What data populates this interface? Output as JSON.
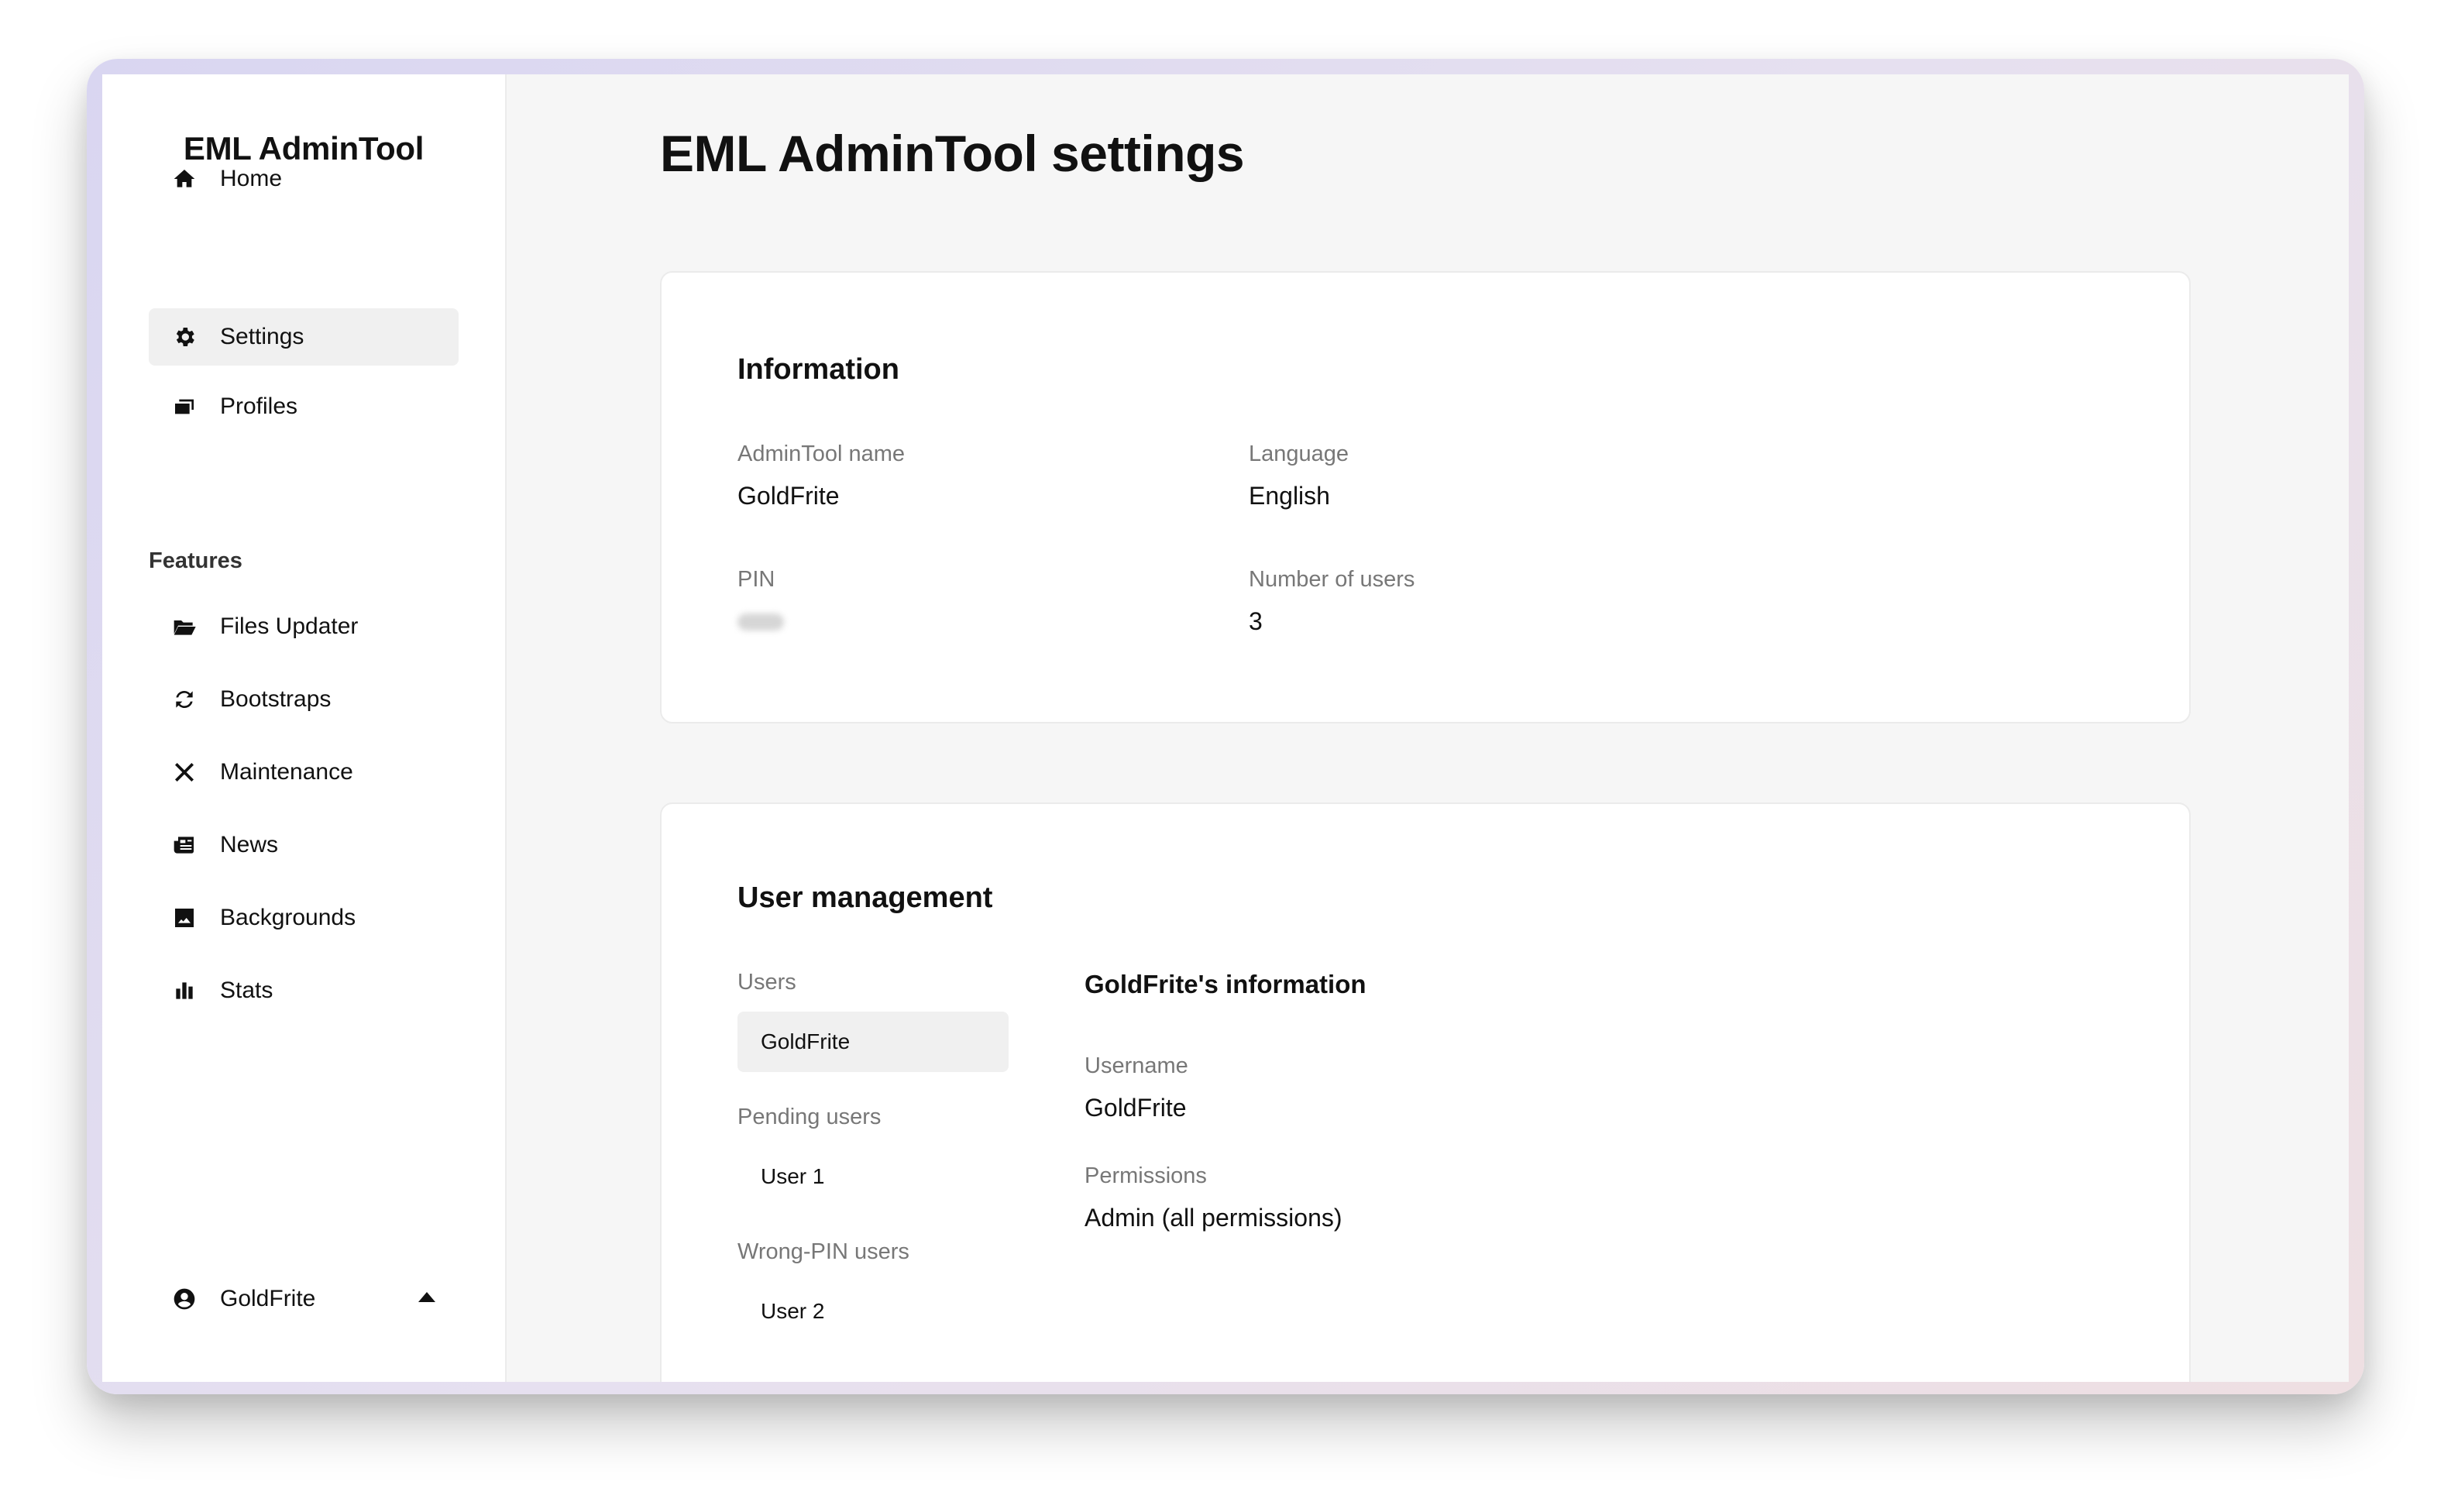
{
  "sidebar": {
    "app_title": "EML AdminTool",
    "nav": [
      {
        "label": "Home",
        "icon": "home-icon"
      },
      {
        "label": "Settings",
        "icon": "gear-icon"
      },
      {
        "label": "Profiles",
        "icon": "profiles-icon"
      }
    ],
    "features_title": "Features",
    "features": [
      {
        "label": "Files Updater",
        "icon": "folder-open-icon"
      },
      {
        "label": "Bootstraps",
        "icon": "refresh-icon"
      },
      {
        "label": "Maintenance",
        "icon": "tools-icon"
      },
      {
        "label": "News",
        "icon": "newspaper-icon"
      },
      {
        "label": "Backgrounds",
        "icon": "image-icon"
      },
      {
        "label": "Stats",
        "icon": "bar-chart-icon"
      }
    ],
    "active_item": "Settings",
    "user": {
      "name": "GoldFrite",
      "icon": "user-circle-icon",
      "toggle_icon": "caret-up-icon"
    }
  },
  "main": {
    "page_title": "EML AdminTool settings",
    "information": {
      "title": "Information",
      "admintool_name_label": "AdminTool name",
      "admintool_name_value": "GoldFrite",
      "language_label": "Language",
      "language_value": "English",
      "pin_label": "PIN",
      "users_count_label": "Number of users",
      "users_count_value": "3"
    },
    "user_management": {
      "title": "User management",
      "users_label": "Users",
      "users": [
        "GoldFrite"
      ],
      "pending_label": "Pending users",
      "pending": [
        "User 1"
      ],
      "wrong_pin_label": "Wrong-PIN users",
      "wrong_pin": [
        "User 2"
      ],
      "detail_title": "GoldFrite's information",
      "username_label": "Username",
      "username_value": "GoldFrite",
      "permissions_label": "Permissions",
      "permissions_value": "Admin (all permissions)"
    }
  },
  "colors": {
    "background": "#f6f6f6",
    "sidebar": "#ffffff",
    "active_item": "#f0f0f0",
    "muted_text": "#777777",
    "text": "#111111"
  }
}
